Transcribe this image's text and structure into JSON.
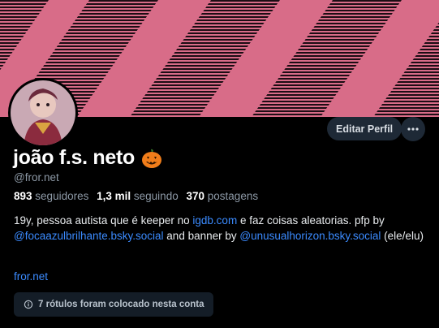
{
  "profile": {
    "display_name": "joão f.s. neto",
    "name_emoji": "jack-o-lantern",
    "handle": "@fror.net",
    "stats": {
      "followers_count": "893",
      "followers_label": "seguidores",
      "following_count": "1,3 mil",
      "following_label": "seguindo",
      "posts_count": "370",
      "posts_label": "postagens"
    },
    "bio": {
      "part1": "19y, pessoa autista que é keeper no ",
      "link1": "igdb.com",
      "part2": " e faz coisas aleatorias. pfp by ",
      "link2": "@focaazulbrilhante.bsky.social",
      "part3": " and banner by ",
      "link3": "@unusualhorizon.bsky.social",
      "part4": " (ele/elu)"
    },
    "website": "fror.net",
    "labels_notice": "7 rótulos foram colocado nesta conta"
  },
  "actions": {
    "edit_profile_label": "Editar Perfil",
    "more_icon": "ellipsis-icon"
  },
  "colors": {
    "banner_pink": "#d86c88",
    "banner_stripe": "#1c0d14",
    "link": "#3b8bff",
    "background": "#000000"
  }
}
